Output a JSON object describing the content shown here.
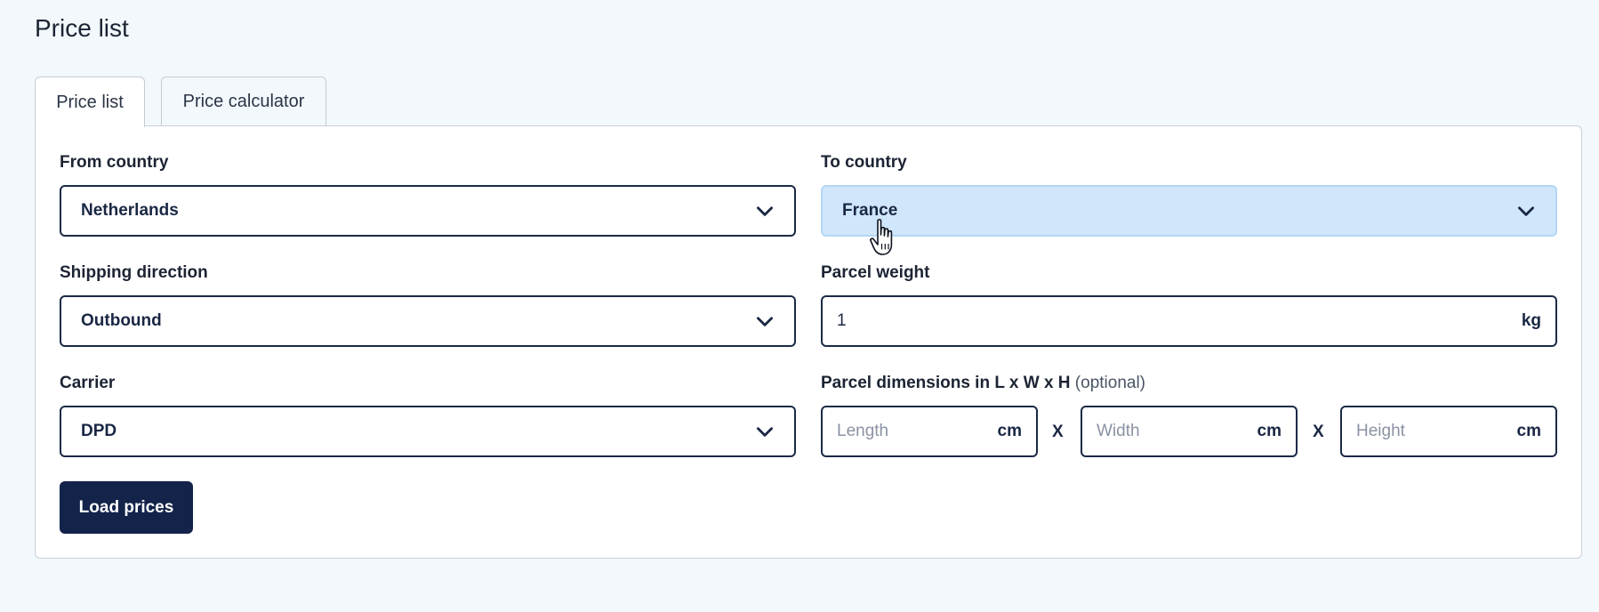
{
  "page": {
    "title": "Price list"
  },
  "tabs": [
    {
      "label": "Price list",
      "active": true
    },
    {
      "label": "Price calculator",
      "active": false
    }
  ],
  "form": {
    "from_country": {
      "label": "From country",
      "value": "Netherlands"
    },
    "to_country": {
      "label": "To country",
      "value": "France"
    },
    "shipping_direction": {
      "label": "Shipping direction",
      "value": "Outbound"
    },
    "parcel_weight": {
      "label": "Parcel weight",
      "value": "1",
      "unit": "kg"
    },
    "carrier": {
      "label": "Carrier",
      "value": "DPD"
    },
    "dimensions": {
      "label": "Parcel dimensions in L x W x H",
      "optional": "(optional)",
      "separator": "X",
      "length": {
        "placeholder": "Length",
        "unit": "cm"
      },
      "width": {
        "placeholder": "Width",
        "unit": "cm"
      },
      "height": {
        "placeholder": "Height",
        "unit": "cm"
      }
    },
    "load_button": "Load prices"
  },
  "icons": {
    "dropdown": "chevron-down-icon",
    "cursor": "hand-pointer-icon"
  },
  "colors": {
    "primary": "#13234a",
    "highlight": "#cfe6fb",
    "background": "#f3f8fc"
  }
}
